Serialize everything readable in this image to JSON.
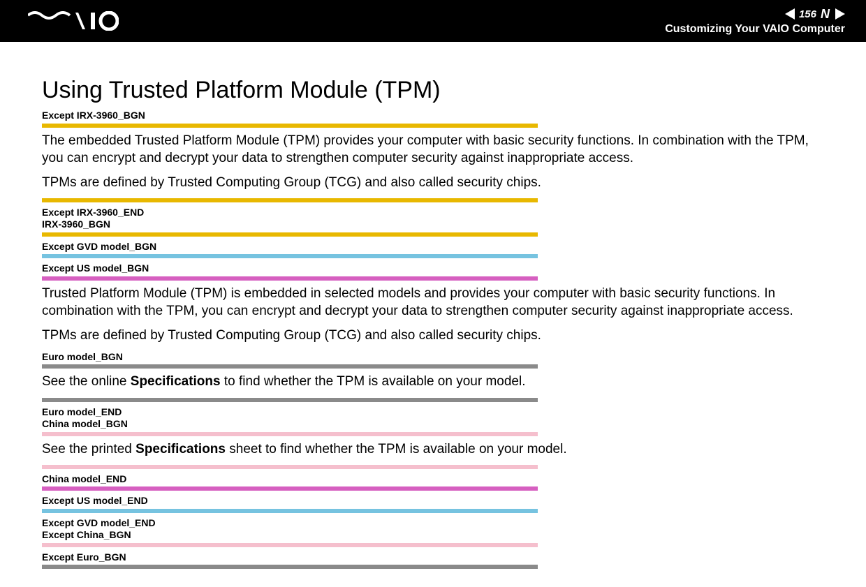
{
  "header": {
    "page_number": "156",
    "nav_N": "N",
    "section_title": "Customizing Your VAIO Computer"
  },
  "title": "Using Trusted Platform Module (TPM)",
  "tags": {
    "t1": "Except IRX-3960_BGN",
    "t2a": "Except IRX-3960_END",
    "t2b": "IRX-3960_BGN",
    "t3": "Except GVD model_BGN",
    "t4": "Except US model_BGN",
    "t5": "Euro model_BGN",
    "t6a": "Euro model_END",
    "t6b": "China model_BGN",
    "t7": "China model_END",
    "t8": "Except US model_END",
    "t9a": "Except GVD model_END",
    "t9b": "Except China_BGN",
    "t10": "Except Euro_BGN"
  },
  "paras": {
    "p1": "The embedded Trusted Platform Module (TPM) provides your computer with basic security functions. In combination with the TPM, you can encrypt and decrypt your data to strengthen computer security against inappropriate access.",
    "p2": "TPMs are defined by Trusted Computing Group (TCG) and also called security chips.",
    "p3": "Trusted Platform Module (TPM) is embedded in selected models and provides your computer with basic security functions. In combination with the TPM, you can encrypt and decrypt your data to strengthen computer security against inappropriate access.",
    "p4": "TPMs are defined by Trusted Computing Group (TCG) and also called security chips.",
    "p5_pre": "See the online ",
    "p5_bold": "Specifications",
    "p5_post": " to find whether the TPM is available on your model.",
    "p6_pre": "See the printed ",
    "p6_bold": "Specifications",
    "p6_post": " sheet to find whether the TPM is available on your model."
  }
}
